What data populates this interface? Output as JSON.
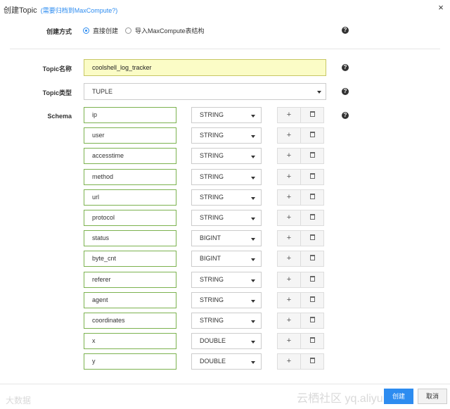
{
  "dialog": {
    "title": "创建Topic",
    "title_link": "(需要归档到MaxCompute?)",
    "close_glyph": "×"
  },
  "create_mode": {
    "label": "创建方式",
    "options": [
      {
        "label": "直接创建",
        "selected": true
      },
      {
        "label": "导入MaxCompute表结构",
        "selected": false
      }
    ]
  },
  "topic_name": {
    "label": "Topic名称",
    "value": "coolshell_log_tracker"
  },
  "topic_type": {
    "label": "Topic类型",
    "value": "TUPLE"
  },
  "schema": {
    "label": "Schema",
    "fields": [
      {
        "name": "ip",
        "type": "STRING"
      },
      {
        "name": "user",
        "type": "STRING"
      },
      {
        "name": "accesstime",
        "type": "STRING"
      },
      {
        "name": "method",
        "type": "STRING"
      },
      {
        "name": "url",
        "type": "STRING"
      },
      {
        "name": "protocol",
        "type": "STRING"
      },
      {
        "name": "status",
        "type": "BIGINT"
      },
      {
        "name": "byte_cnt",
        "type": "BIGINT"
      },
      {
        "name": "referer",
        "type": "STRING"
      },
      {
        "name": "agent",
        "type": "STRING"
      },
      {
        "name": "coordinates",
        "type": "STRING"
      },
      {
        "name": "x",
        "type": "DOUBLE"
      },
      {
        "name": "y",
        "type": "DOUBLE"
      }
    ],
    "add_glyph": "+"
  },
  "help_glyph": "?",
  "footer": {
    "ok_label": "创建",
    "cancel_label": "取消"
  },
  "watermarks": [
    "大数据",
    "云栖社区 yq.aliyun.com"
  ],
  "colors": {
    "accent": "#2d8cf0",
    "field_border": "#7cb24f",
    "highlight_bg": "#fbfcc6"
  }
}
